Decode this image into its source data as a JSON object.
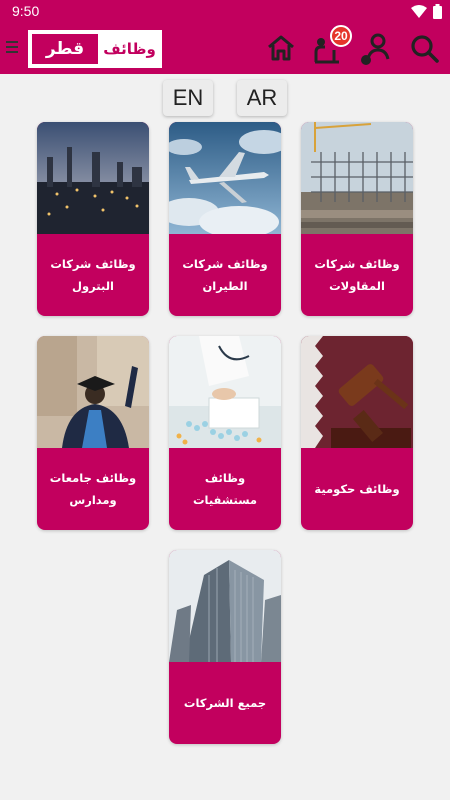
{
  "status_bar": {
    "time": "9:50",
    "icons": [
      "wifi-icon",
      "battery-icon"
    ]
  },
  "app_bar": {
    "logo_left": "قطر",
    "logo_right": "وظائف",
    "notification_count": "20",
    "icons": [
      "menu-icon",
      "home-icon",
      "notifications-icon",
      "profile-icon",
      "search-icon"
    ]
  },
  "languages": {
    "en": "EN",
    "ar": "AR"
  },
  "categories": [
    {
      "label": "وظائف شركات المقاولات",
      "image": "construction-image"
    },
    {
      "label": "وظائف شركات الطيران",
      "image": "airplane-image"
    },
    {
      "label": "وظائف شركات البترول",
      "image": "refinery-image"
    },
    {
      "label": "وظائف حكومية",
      "image": "gavel-flag-image"
    },
    {
      "label": "وظائف مستشفيات",
      "image": "doctor-image"
    },
    {
      "label": "وظائف جامعات ومدارس",
      "image": "graduate-image"
    },
    {
      "label": "جميع الشركات",
      "image": "skyscraper-image"
    }
  ],
  "colors": {
    "brand": "#c2005e",
    "background": "#f1f1f1",
    "badge": "#e5352b"
  }
}
